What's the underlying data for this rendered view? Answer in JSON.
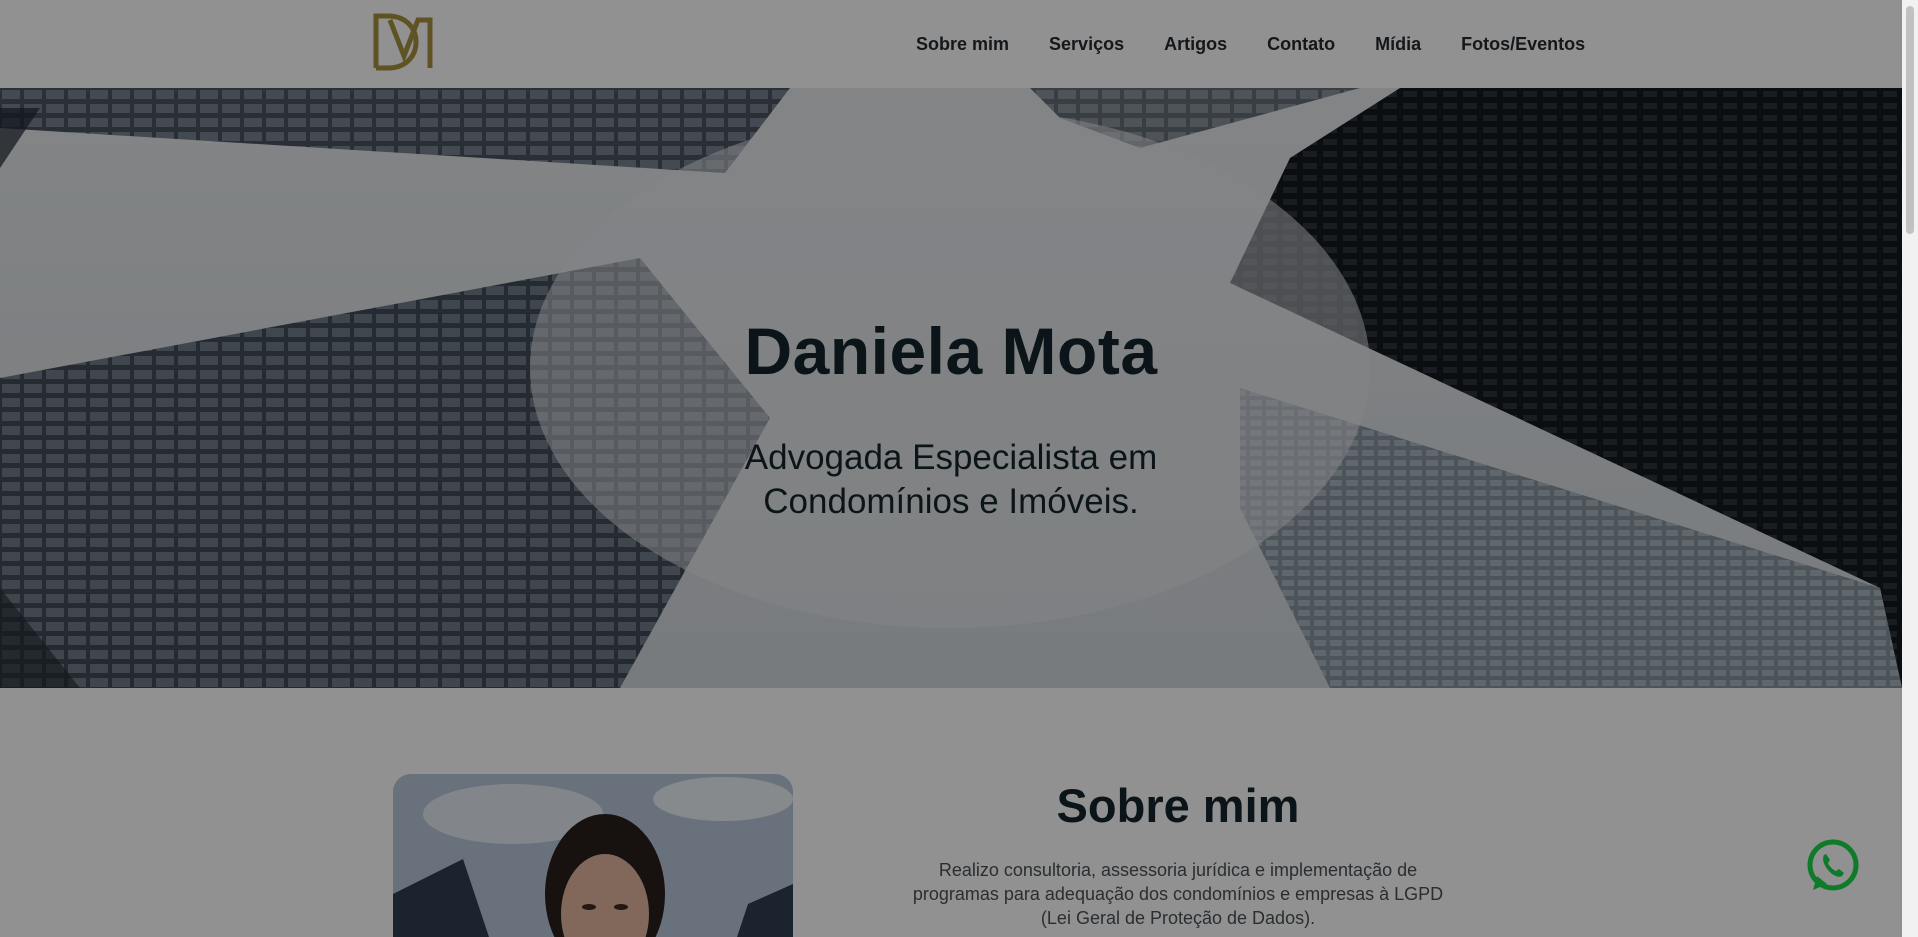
{
  "nav": {
    "items": [
      "Sobre mim",
      "Serviços",
      "Artigos",
      "Contato",
      "Mídia",
      "Fotos/Eventos"
    ]
  },
  "brand": {
    "accent": "#a8913f"
  },
  "hero": {
    "title": "Daniela Mota",
    "subtitle_line1": "Advogada Especialista em",
    "subtitle_line2": "Condomínios e Imóveis."
  },
  "about": {
    "title": "Sobre mim",
    "text_line1": "Realizo consultoria, assessoria jurídica e implementação de",
    "text_line2": "programas para adequação dos condomínios e empresas à LGPD",
    "text_line3": "(Lei Geral de Proteção de Dados)."
  },
  "icons": {
    "logo": "dm-monogram-logo",
    "whatsapp": "whatsapp-icon"
  },
  "colors": {
    "whatsapp": "#0f7a2a"
  }
}
